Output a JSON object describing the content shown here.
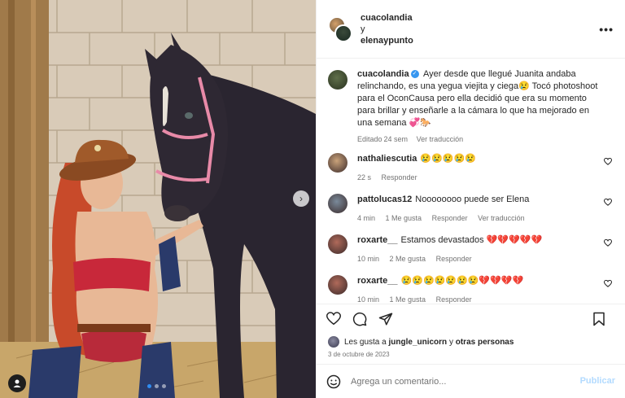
{
  "header": {
    "user1": "cuacolandia",
    "conj": "y",
    "user2": "elenaypunto",
    "more": "•••"
  },
  "caption": {
    "username": "cuacolandia",
    "text": "Ayer desde que llegué Juanita andaba relinchando, es una yegua viejita y ciega😢 Tocó photoshoot para el OconCausa pero ella decidió que era su momento para brillar y enseñarle a la cámara lo que ha mejorado en una semana 💞🐎",
    "edited": "Editado",
    "time": "24 sem",
    "translation": "Ver traducción"
  },
  "comments": [
    {
      "username": "nathaliescutia",
      "text": "😢😢😢😢😢",
      "time": "22 s",
      "likes": "",
      "reply": "Responder",
      "translate": "",
      "avatar_color": "#c9a27a"
    },
    {
      "username": "pattolucas12",
      "text": "Noooooooo puede ser Elena",
      "time": "4 min",
      "likes": "1 Me gusta",
      "reply": "Responder",
      "translate": "Ver traducción",
      "avatar_color": "#7a8a9a"
    },
    {
      "username": "roxarte__",
      "text": "Estamos devastados 💔💔💔💔💔",
      "time": "10 min",
      "likes": "2 Me gusta",
      "reply": "Responder",
      "translate": "",
      "avatar_color": "#b06a5a"
    },
    {
      "username": "roxarte__",
      "text": "😢😢😢😢😢😢😢💔💔💔💔",
      "time": "10 min",
      "likes": "1 Me gusta",
      "reply": "Responder",
      "translate": "",
      "avatar_color": "#b06a5a"
    }
  ],
  "likes": {
    "prefix": "Les gusta a",
    "user": "jungle_unicorn",
    "mid": "y",
    "rest": "otras personas"
  },
  "date": "3 de octubre de 2023",
  "add_comment": {
    "placeholder": "Agrega un comentario...",
    "publish": "Publicar"
  },
  "carousel": {
    "next": "›",
    "total": 3,
    "active": 1
  }
}
